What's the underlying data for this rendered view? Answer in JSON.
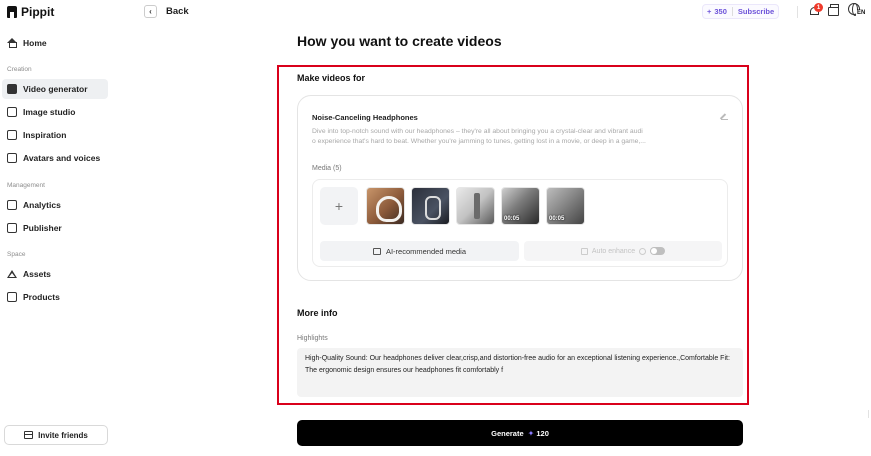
{
  "app": {
    "name": "Pippit"
  },
  "sidebar": {
    "sections": [
      {
        "label": "Creation"
      },
      {
        "label": "Management"
      },
      {
        "label": "Space"
      }
    ],
    "items": [
      {
        "label": "Home",
        "icon": "home-icon"
      },
      {
        "label": "Video generator",
        "icon": "video-generator-icon",
        "active": true
      },
      {
        "label": "Image studio",
        "icon": "image-studio-icon"
      },
      {
        "label": "Inspiration",
        "icon": "inspiration-icon"
      },
      {
        "label": "Avatars and voices",
        "icon": "avatar-icon"
      },
      {
        "label": "Analytics",
        "icon": "analytics-icon"
      },
      {
        "label": "Publisher",
        "icon": "calendar-icon"
      },
      {
        "label": "Assets",
        "icon": "assets-icon"
      },
      {
        "label": "Products",
        "icon": "products-icon"
      }
    ],
    "invite_label": "Invite friends"
  },
  "topbar": {
    "back_label": "Back",
    "credits": "350",
    "subscribe_label": "Subscribe",
    "notification_count": "1",
    "language": "EN"
  },
  "main": {
    "title": "How you want to create videos",
    "make_videos_for": "Make videos for",
    "product": {
      "name": "Noise-Canceling Headphones",
      "description_line1": "Dive into top-notch sound with our headphones – they're all about bringing you a crystal-clear and vibrant audi",
      "description_line2": "o experience that's hard to beat. Whether you're jamming to tunes, getting lost in a movie, or deep in a game,..."
    },
    "media": {
      "label": "Media (5)",
      "add_symbol": "+",
      "items": [
        {
          "type": "image",
          "duration": ""
        },
        {
          "type": "image",
          "duration": ""
        },
        {
          "type": "image",
          "duration": ""
        },
        {
          "type": "video",
          "duration": "00:05"
        },
        {
          "type": "video",
          "duration": "00:05"
        }
      ],
      "ai_recommended_label": "AI-recommended media",
      "auto_enhance_label": "Auto enhance"
    },
    "more_info": "More info",
    "highlights_label": "Highlights",
    "highlights_text": "High-Quality Sound: Our headphones deliver clear,crisp,and distortion-free audio for an exceptional listening experience.,Comfortable Fit: The ergonomic design ensures our headphones fit comfortably f",
    "generate_label": "Generate",
    "generate_cost": "120"
  },
  "colors": {
    "accent": "#6c52d9",
    "highlight_frame": "#d9001b",
    "generate_bg": "#000000"
  }
}
